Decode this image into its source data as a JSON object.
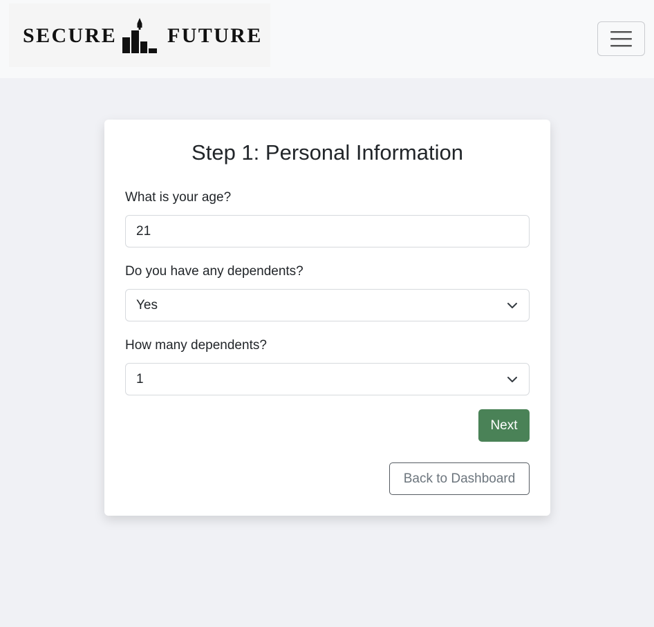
{
  "brand": {
    "left_word": "SECURE",
    "right_word": "FUTURE",
    "logo_icon": "bar-chart-rocket-icon"
  },
  "navbar": {
    "toggle_icon": "hamburger-menu-icon"
  },
  "form": {
    "title": "Step 1: Personal Information",
    "age": {
      "label": "What is your age?",
      "value": "21"
    },
    "dependents": {
      "label": "Do you have any dependents?",
      "selected": "Yes"
    },
    "dependents_count": {
      "label": "How many dependents?",
      "selected": "1"
    },
    "next_label": "Next",
    "back_label": "Back to Dashboard"
  },
  "colors": {
    "page_bg": "#f0f1f5",
    "navbar_bg": "#f8f9fa",
    "primary_button": "#4a8257",
    "text": "#212529",
    "muted_text": "#6c757d"
  }
}
